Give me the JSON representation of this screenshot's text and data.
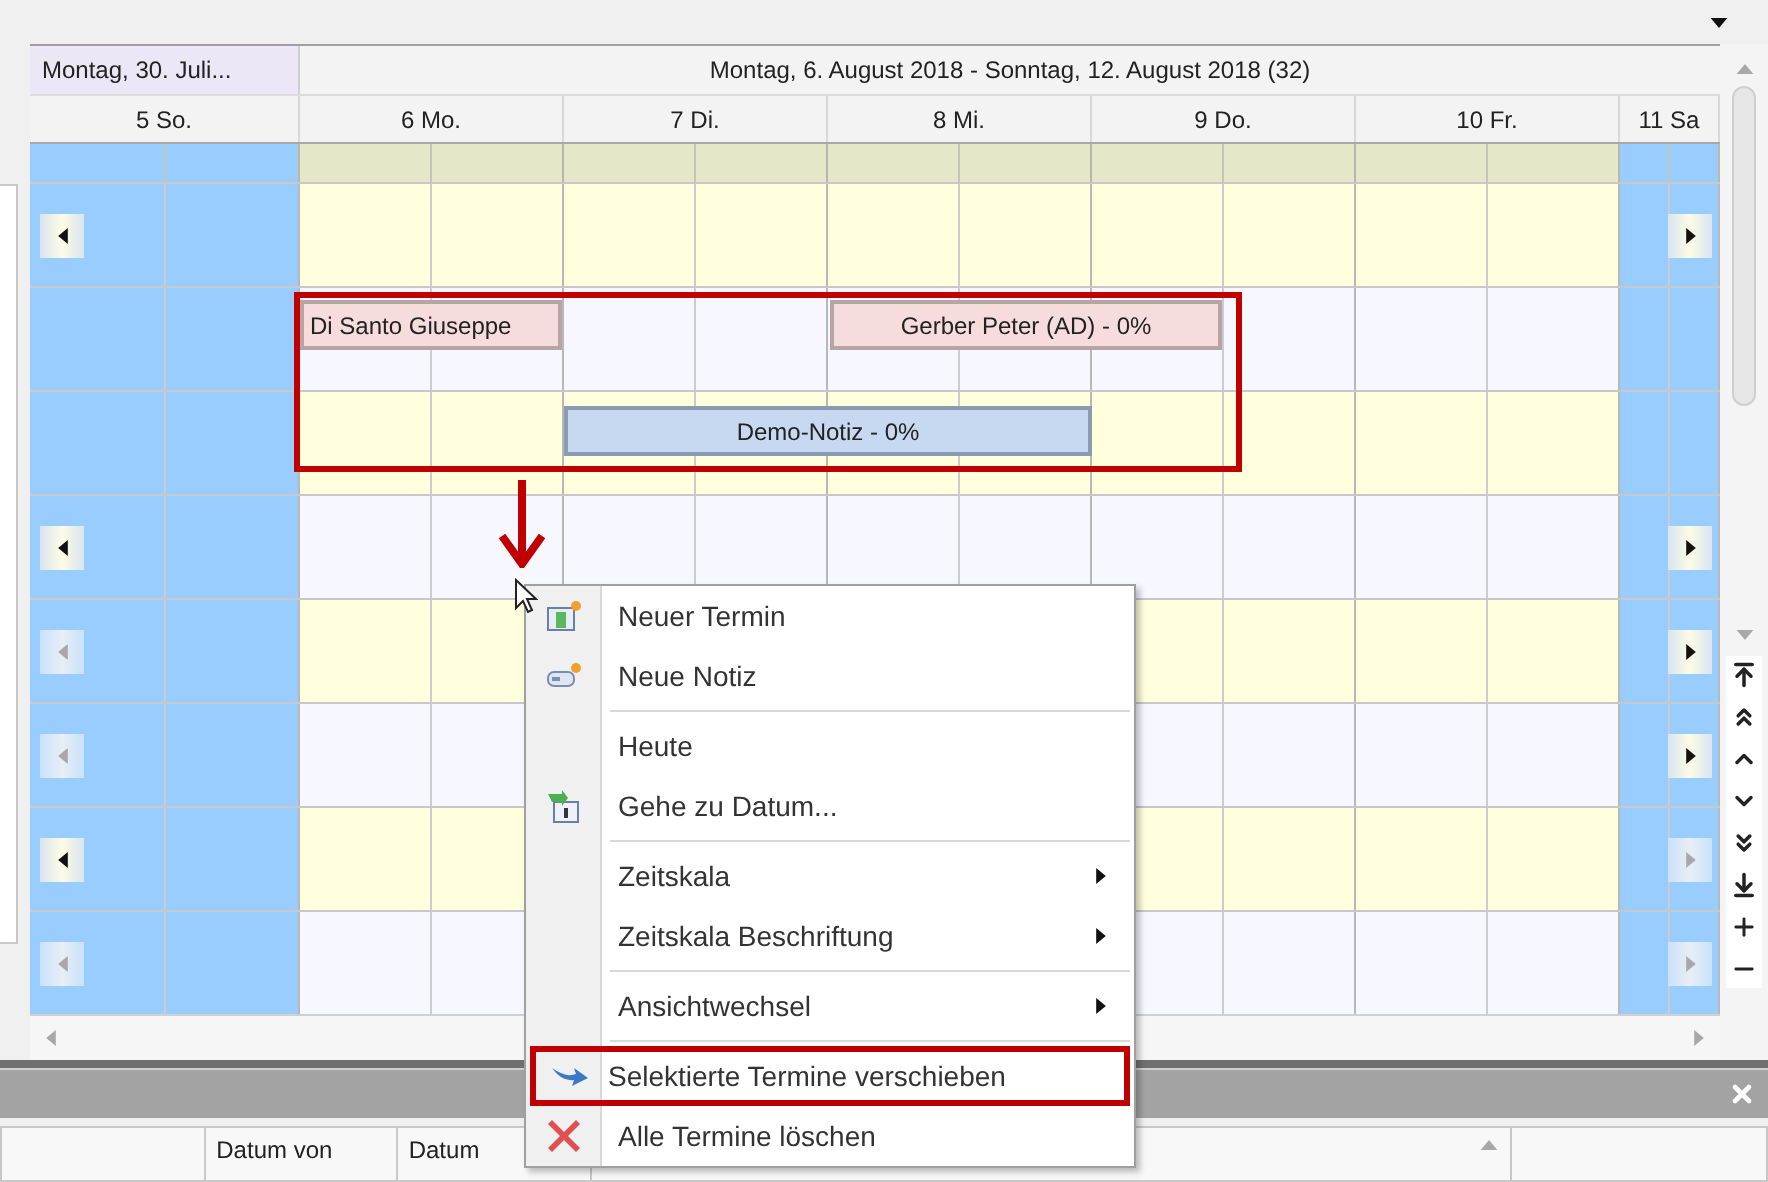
{
  "header": {
    "previous_range": "Montag, 30. Juli...",
    "range": "Montag, 6. August 2018 - Sonntag, 12. August 2018 (32)"
  },
  "days": [
    {
      "label": "5 So.",
      "weekend": true
    },
    {
      "label": "6 Mo.",
      "weekend": false
    },
    {
      "label": "7 Di.",
      "weekend": false
    },
    {
      "label": "8 Mi.",
      "weekend": false
    },
    {
      "label": "9 Do.",
      "weekend": false
    },
    {
      "label": "10 Fr.",
      "weekend": false
    },
    {
      "label": "11 Sa",
      "weekend": true
    }
  ],
  "rows": [
    {
      "left_arrow": {
        "dimmed": false
      },
      "right_arrow": {
        "dimmed": false
      }
    },
    {},
    {},
    {
      "left_arrow": {
        "dimmed": false
      },
      "right_arrow": {
        "dimmed": false
      }
    },
    {
      "left_arrow": {
        "dimmed": true
      },
      "right_arrow": {
        "dimmed": false
      }
    },
    {
      "left_arrow": {
        "dimmed": true
      },
      "right_arrow": {
        "dimmed": false
      }
    },
    {
      "left_arrow": {
        "dimmed": false
      },
      "right_arrow": {
        "dimmed": true
      }
    },
    {
      "left_arrow": {
        "dimmed": true
      },
      "right_arrow": {
        "dimmed": true
      }
    }
  ],
  "appointments": [
    {
      "kind": "appointment",
      "label": "Di Santo Giuseppe"
    },
    {
      "kind": "appointment",
      "label": "Gerber Peter (AD) - 0%"
    },
    {
      "kind": "note",
      "label": "Demo-Notiz - 0%"
    }
  ],
  "context_menu": [
    {
      "kind": "item",
      "label": "Neuer Termin",
      "submenu": false,
      "highlighted": false
    },
    {
      "kind": "item",
      "label": "Neue Notiz",
      "submenu": false,
      "highlighted": false
    },
    {
      "kind": "separator"
    },
    {
      "kind": "item",
      "label": "Heute",
      "submenu": false,
      "highlighted": false
    },
    {
      "kind": "item",
      "label": "Gehe zu Datum...",
      "submenu": false,
      "highlighted": false
    },
    {
      "kind": "separator"
    },
    {
      "kind": "item",
      "label": "Zeitskala",
      "submenu": true,
      "highlighted": false
    },
    {
      "kind": "item",
      "label": "Zeitskala Beschriftung",
      "submenu": true,
      "highlighted": false
    },
    {
      "kind": "separator"
    },
    {
      "kind": "item",
      "label": "Ansichtwechsel",
      "submenu": true,
      "highlighted": false
    },
    {
      "kind": "separator"
    },
    {
      "kind": "item",
      "label": "Selektierte Termine verschieben",
      "submenu": false,
      "highlighted": true
    },
    {
      "kind": "item",
      "label": "Alle Termine löschen",
      "submenu": false,
      "highlighted": false
    }
  ],
  "grid_columns": [
    "Datum von",
    "Datum"
  ]
}
